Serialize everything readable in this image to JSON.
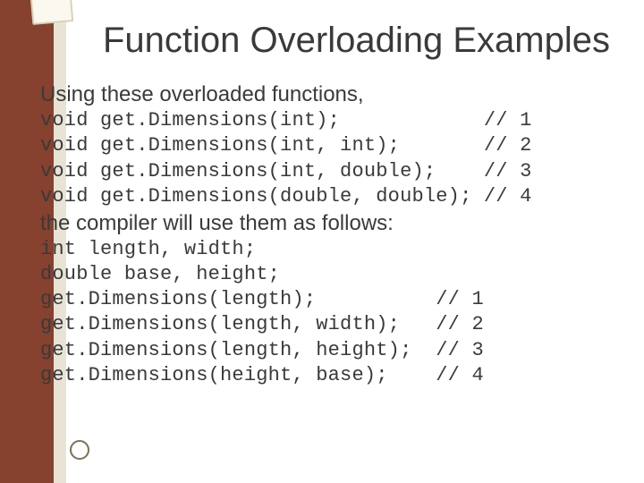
{
  "title": "Function Overloading Examples",
  "intro": "Using these overloaded functions,",
  "decl": [
    "void get.Dimensions(int);            // 1",
    "void get.Dimensions(int, int);       // 2",
    "void get.Dimensions(int, double);    // 3",
    "void get.Dimensions(double, double); // 4"
  ],
  "mid": "the compiler will use them as follows:",
  "usage": [
    "int length, width;",
    "double base, height;",
    "get.Dimensions(length);          // 1",
    "get.Dimensions(length, width);   // 2",
    "get.Dimensions(length, height);  // 3",
    "get.Dimensions(height, base);    // 4"
  ]
}
